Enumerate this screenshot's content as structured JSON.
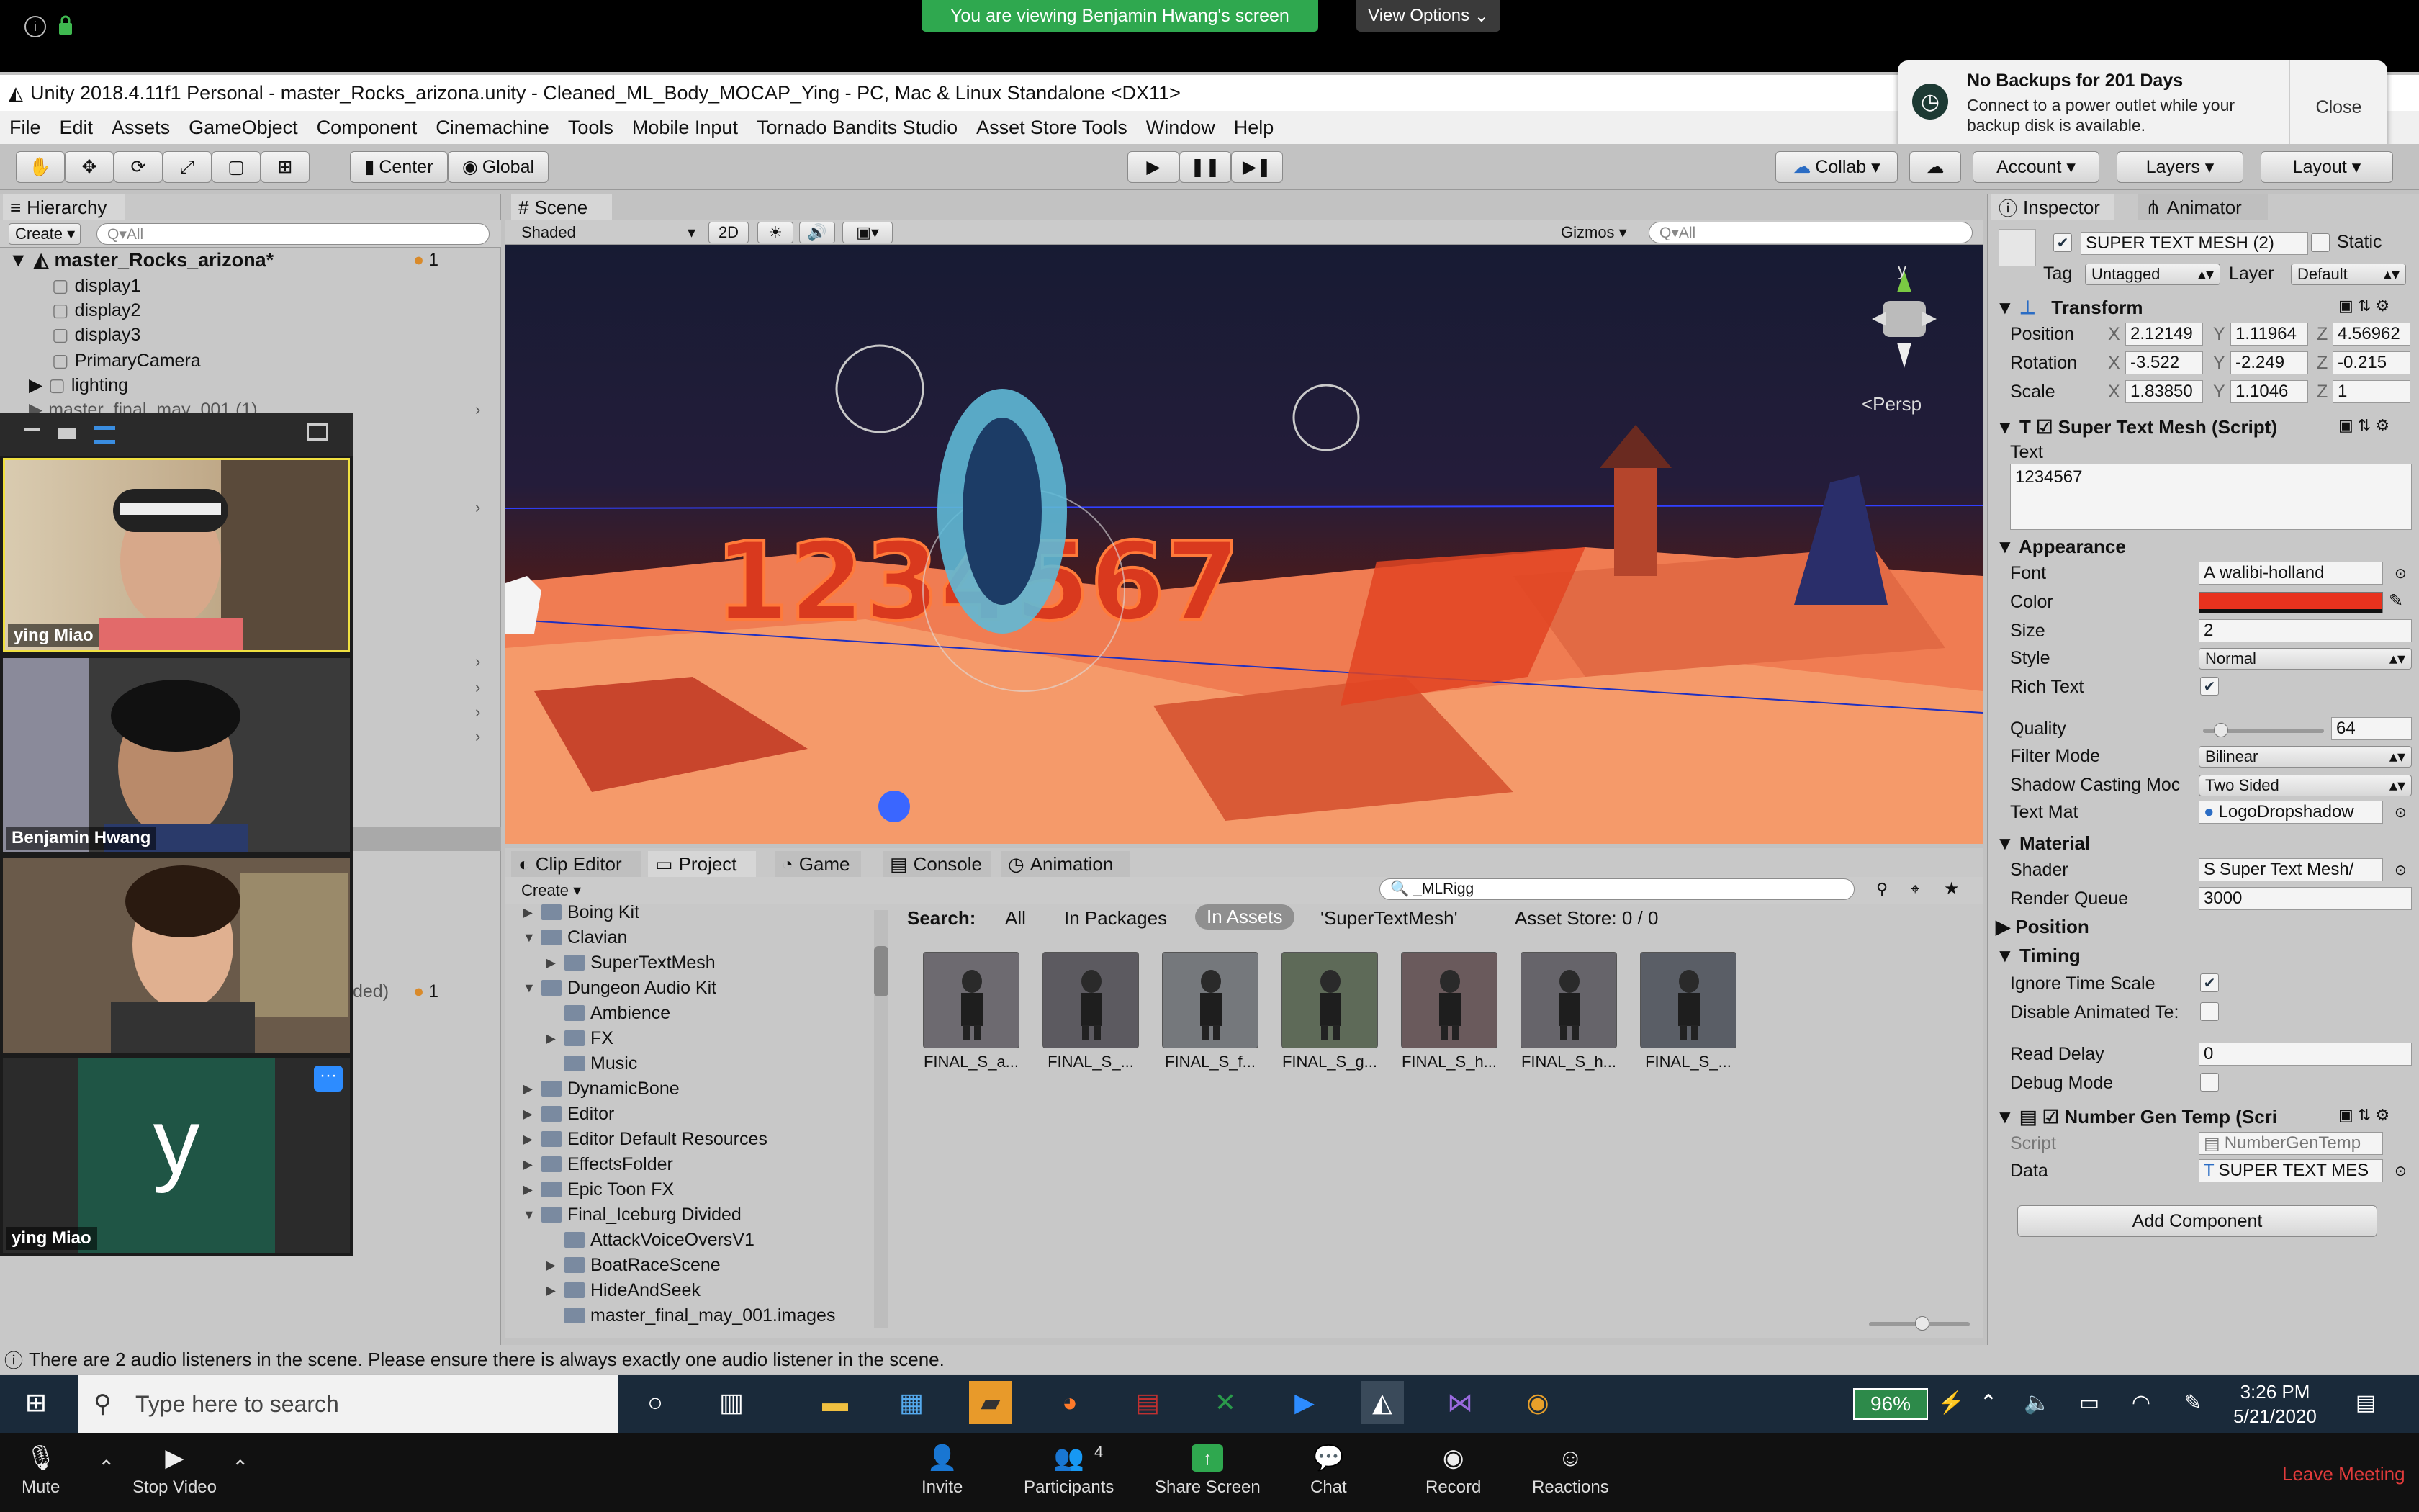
{
  "zoom": {
    "banner": "You are viewing Benjamin Hwang's screen",
    "view_options": "View Options",
    "bottom": {
      "mute": "Mute",
      "stop_video": "Stop Video",
      "invite": "Invite",
      "participants": "Participants",
      "participants_count": "4",
      "share_screen": "Share Screen",
      "chat": "Chat",
      "record": "Record",
      "reactions": "Reactions",
      "leave": "Leave Meeting"
    },
    "gallery": [
      {
        "name": "ying Miao"
      },
      {
        "name": "Benjamin Hwang"
      },
      {
        "name": ""
      },
      {
        "name": "ying Miao",
        "initial": "y"
      }
    ]
  },
  "notification": {
    "title": "No Backups for 201 Days",
    "body": "Connect to a power outlet while your backup disk is available.",
    "close": "Close"
  },
  "unity": {
    "title": "Unity 2018.4.11f1 Personal - master_Rocks_arizona.unity - Cleaned_ML_Body_MOCAP_Ying - PC, Mac & Linux Standalone <DX11>",
    "menu": [
      "File",
      "Edit",
      "Assets",
      "GameObject",
      "Component",
      "Cinemachine",
      "Tools",
      "Mobile Input",
      "Tornado Bandits Studio",
      "Asset Store Tools",
      "Window",
      "Help"
    ],
    "toolbar": {
      "center": "Center",
      "global": "Global",
      "collab": "Collab",
      "account": "Account",
      "layers": "Layers",
      "layout": "Layout"
    },
    "hierarchy": {
      "tab": "Hierarchy",
      "create": "Create",
      "search_placeholder": "Q▾All",
      "scene_name": "master_Rocks_arizona*",
      "scene_count": "1",
      "items": [
        "display1",
        "display2",
        "display3",
        "PrimaryCamera",
        "lighting",
        "master_final_may_001 (1)"
      ],
      "lower_label": "ded)",
      "lower_count": "1"
    },
    "scene": {
      "tab": "Scene",
      "shading": "Shaded",
      "mode_2d": "2D",
      "gizmos": "Gizmos",
      "search_placeholder": "Q▾All",
      "persp": "<Persp",
      "axis_y": "y"
    },
    "bottom_tabs": [
      "Clip Editor",
      "Project",
      "Game",
      "Console",
      "Animation"
    ],
    "project": {
      "create": "Create",
      "search_value": "_MLRigg",
      "search_label": "Search:",
      "filters": [
        "All",
        "In Packages",
        "In Assets",
        "'SuperTextMesh'"
      ],
      "asset_store": "Asset Store: 0 / 0",
      "tree": [
        {
          "label": "Boing Kit",
          "indent": 0,
          "arrow": "▶"
        },
        {
          "label": "Clavian",
          "indent": 0,
          "arrow": "▼"
        },
        {
          "label": "SuperTextMesh",
          "indent": 1,
          "arrow": "▶"
        },
        {
          "label": "Dungeon Audio Kit",
          "indent": 0,
          "arrow": "▼"
        },
        {
          "label": "Ambience",
          "indent": 1,
          "arrow": ""
        },
        {
          "label": "FX",
          "indent": 1,
          "arrow": "▶"
        },
        {
          "label": "Music",
          "indent": 1,
          "arrow": ""
        },
        {
          "label": "DynamicBone",
          "indent": 0,
          "arrow": "▶"
        },
        {
          "label": "Editor",
          "indent": 0,
          "arrow": "▶"
        },
        {
          "label": "Editor Default Resources",
          "indent": 0,
          "arrow": "▶"
        },
        {
          "label": "EffectsFolder",
          "indent": 0,
          "arrow": "▶"
        },
        {
          "label": "Epic Toon FX",
          "indent": 0,
          "arrow": "▶"
        },
        {
          "label": "Final_Iceburg Divided",
          "indent": 0,
          "arrow": "▼"
        },
        {
          "label": "AttackVoiceOversV1",
          "indent": 1,
          "arrow": ""
        },
        {
          "label": "BoatRaceScene",
          "indent": 1,
          "arrow": "▶"
        },
        {
          "label": "HideAndSeek",
          "indent": 1,
          "arrow": "▶"
        },
        {
          "label": "master_final_may_001.images",
          "indent": 1,
          "arrow": ""
        }
      ],
      "assets": [
        "FINAL_S_a...",
        "FINAL_S_...",
        "FINAL_S_f...",
        "FINAL_S_g...",
        "FINAL_S_h...",
        "FINAL_S_h...",
        "FINAL_S_..."
      ]
    },
    "inspector": {
      "tab": "Inspector",
      "tab2": "Animator",
      "object_name": "SUPER TEXT MESH (2)",
      "static": "Static",
      "tag_label": "Tag",
      "tag_value": "Untagged",
      "layer_label": "Layer",
      "layer_value": "Default",
      "transform": "Transform",
      "position": {
        "label": "Position",
        "x": "2.12149",
        "y": "1.11964",
        "z": "4.56962"
      },
      "rotation": {
        "label": "Rotation",
        "x": "-3.522",
        "y": "-2.249",
        "z": "-0.215"
      },
      "scale": {
        "label": "Scale",
        "x": "1.83850",
        "y": "1.1046",
        "z": "1"
      },
      "stm_header": "Super Text Mesh (Script)",
      "text_label": "Text",
      "text_value": "1234567",
      "appearance": "Appearance",
      "font_label": "Font",
      "font_value": "walibi-holland",
      "color_label": "Color",
      "color_value": "#e8321e",
      "size_label": "Size",
      "size_value": "2",
      "style_label": "Style",
      "style_value": "Normal",
      "rich_text_label": "Rich Text",
      "quality_label": "Quality",
      "quality_value": "64",
      "quality_fraction": 0.1,
      "filter_label": "Filter Mode",
      "filter_value": "Bilinear",
      "shadow_label": "Shadow Casting Moc",
      "shadow_value": "Two Sided",
      "textmat_label": "Text Mat",
      "textmat_value": "LogoDropshadow",
      "material": "Material",
      "shader_label": "Shader",
      "shader_value": "Super Text Mesh/",
      "renderq_label": "Render Queue",
      "renderq_value": "3000",
      "position_section": "Position",
      "timing": "Timing",
      "ignore_time_label": "Ignore Time Scale",
      "disable_anim_label": "Disable Animated Te:",
      "read_delay_label": "Read Delay",
      "read_delay_value": "0",
      "debug_label": "Debug Mode",
      "ngt_header": "Number Gen Temp (Scri",
      "script_label": "Script",
      "script_value": "NumberGenTemp",
      "data_label": "Data",
      "data_value": "SUPER TEXT MES",
      "add_component": "Add Component"
    },
    "status": "There are 2 audio listeners in the scene. Please ensure there is always exactly one audio listener in the scene."
  },
  "taskbar": {
    "search_placeholder": "Type here to search",
    "battery": "96%",
    "time": "3:26 PM",
    "date": "5/21/2020"
  }
}
